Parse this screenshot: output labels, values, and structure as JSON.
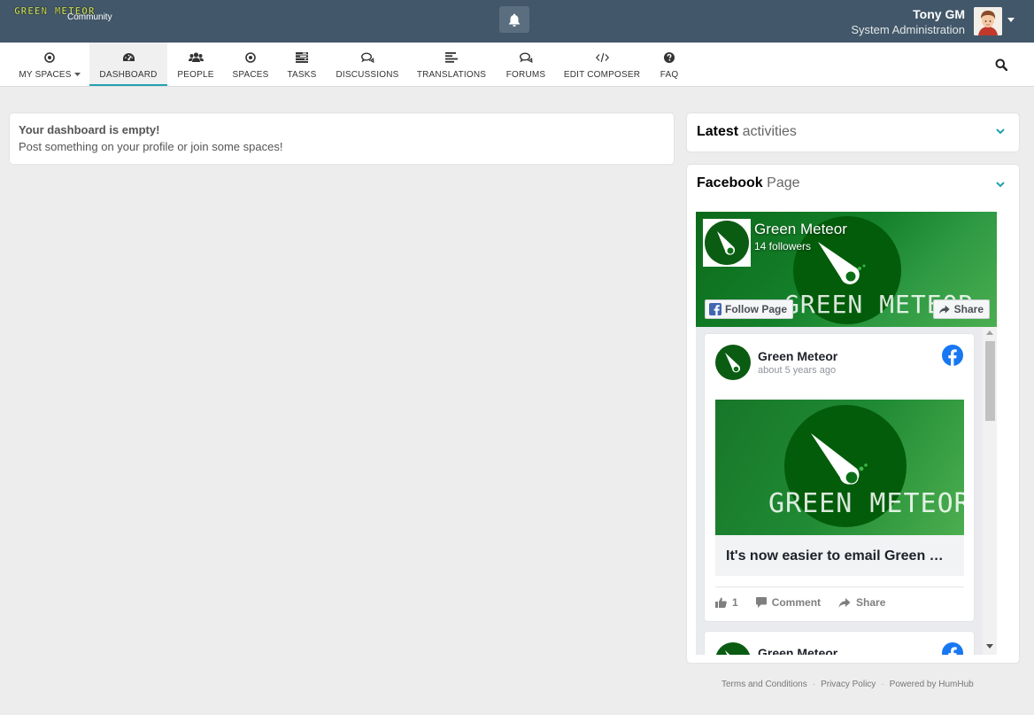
{
  "brand": {
    "logo_text": "GREEN METEOR",
    "subtitle": "Community"
  },
  "user": {
    "name": "Tony GM",
    "role": "System Administration"
  },
  "nav": {
    "items": [
      {
        "label": "MY SPACES",
        "icon": "dot-circle-icon"
      },
      {
        "label": "DASHBOARD",
        "icon": "tachometer-icon"
      },
      {
        "label": "PEOPLE",
        "icon": "users-icon"
      },
      {
        "label": "SPACES",
        "icon": "dot-circle-icon"
      },
      {
        "label": "TASKS",
        "icon": "tasks-icon"
      },
      {
        "label": "DISCUSSIONS",
        "icon": "comments-icon"
      },
      {
        "label": "TRANSLATIONS",
        "icon": "align-left-icon"
      },
      {
        "label": "FORUMS",
        "icon": "comments-icon"
      },
      {
        "label": "EDIT COMPOSER",
        "icon": "code-icon"
      },
      {
        "label": "FAQ",
        "icon": "question-circle-icon"
      }
    ],
    "active": "DASHBOARD"
  },
  "dashboard": {
    "empty_title": "Your dashboard is empty!",
    "empty_text": "Post something on your profile or join some spaces!"
  },
  "panels": {
    "activities": {
      "title_bold": "Latest",
      "title_rest": "activities"
    },
    "facebook": {
      "title_bold": "Facebook",
      "title_rest": "Page"
    }
  },
  "facebook_widget": {
    "page_name": "Green Meteor",
    "followers": "14 followers",
    "follow_label": "Follow Page",
    "share_label": "Share",
    "cover_text": "GREEN METEOR",
    "posts": [
      {
        "author": "Green Meteor",
        "time": "about 5 years ago",
        "image_text": "GREEN METEOR",
        "headline": "It's now easier to email Green Meteor",
        "likes": "1",
        "comment_label": "Comment",
        "share_label": "Share"
      },
      {
        "author": "Green Meteor"
      }
    ]
  },
  "footer": {
    "terms": "Terms and Conditions",
    "privacy": "Privacy Policy",
    "powered": "Powered by HumHub"
  },
  "colors": {
    "topbar": "#425769",
    "accent": "#21a1b3",
    "facebook_blue": "#1877f2",
    "brand_green": "#035c0a"
  }
}
